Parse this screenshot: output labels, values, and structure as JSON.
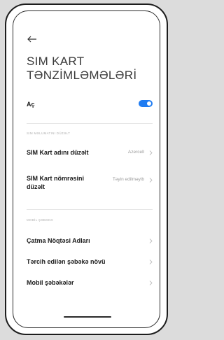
{
  "page": {
    "title_line1": "SIM KART",
    "title_line2": "TƏNZİMLƏMƏLƏRİ"
  },
  "main_toggle": {
    "label": "Aç",
    "state": "on",
    "color": "#1f7cf2"
  },
  "sim_section": {
    "header": "SIM MƏLUMATINI DÜZƏLT",
    "items": [
      {
        "label": "SIM Kart adını düzəlt",
        "value": "Azercell"
      },
      {
        "label_line1": "SIM Kart nömrəsini",
        "label_line2": "düzəlt",
        "value": "Təyin edilməyib"
      }
    ]
  },
  "mobile_section": {
    "header": "MOBİL ŞƏBƏKƏ",
    "items": [
      {
        "label": "Çatma Nöqtəsi Adları"
      },
      {
        "label": "Tərcih edilən şəbəkə növü"
      },
      {
        "label": "Mobil şəbəkələr"
      }
    ]
  },
  "icons": {
    "back": "arrow-left-icon",
    "chevron": "chevron-right-icon"
  }
}
